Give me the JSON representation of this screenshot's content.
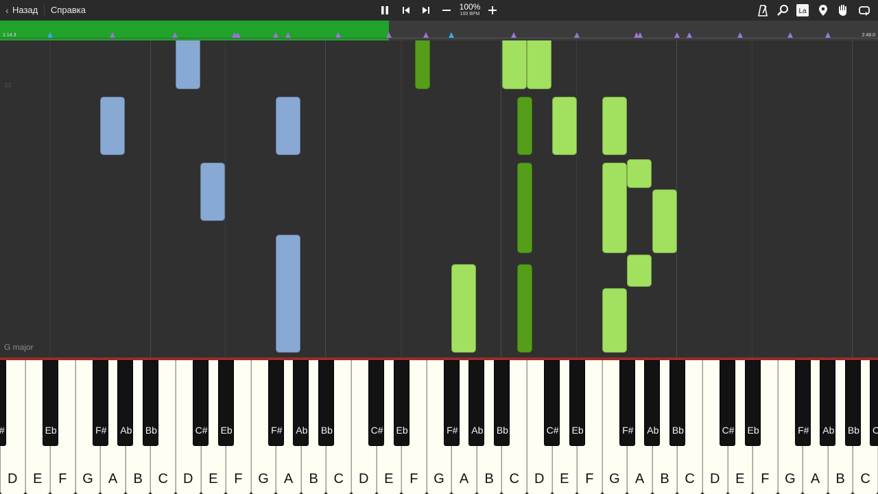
{
  "toolbar": {
    "back_label": "Назад",
    "help_label": "Справка",
    "speed_percent": "100%",
    "speed_bpm": "100 BPM",
    "icons": [
      "pause-icon",
      "skip-back-icon",
      "skip-forward-icon",
      "minus-icon",
      "plus-icon",
      "metronome-icon",
      "search-icon",
      "note-name-icon",
      "location-pin-icon",
      "hand-icon",
      "loop-icon"
    ],
    "note_name_label": "La"
  },
  "timeline": {
    "start_time": "1:14.3",
    "end_time": "2:48.0",
    "played_color": "#1fa32a",
    "progress_fraction": 0.443
  },
  "score": {
    "measure_number": "33",
    "key_signature": "G major",
    "colors": {
      "left_hand": "#88a9d3",
      "right_hand_upcoming": "#a2e05f",
      "right_hand_active": "#559e19",
      "marker": "#9a76d6",
      "marker_active": "#3aa9ef"
    }
  },
  "keyboard": {
    "white_keys": [
      "D",
      "E",
      "F",
      "G",
      "A",
      "B",
      "C",
      "D",
      "E",
      "F",
      "G",
      "A",
      "B",
      "C",
      "D",
      "E",
      "F",
      "G",
      "A",
      "B",
      "C",
      "D",
      "E",
      "F",
      "G",
      "A",
      "B",
      "C",
      "D",
      "E",
      "F",
      "G",
      "A",
      "B",
      "C"
    ],
    "black_keys": [
      "F#",
      "Eb",
      "F#",
      "Ab",
      "Bb",
      "C#",
      "Eb",
      "F#",
      "Ab",
      "Bb",
      "C#",
      "Eb",
      "F#",
      "Ab",
      "Bb",
      "C#",
      "Eb",
      "F#",
      "Ab",
      "Bb",
      "C#",
      "Eb",
      "F#",
      "Ab",
      "Bb",
      "C#"
    ]
  }
}
